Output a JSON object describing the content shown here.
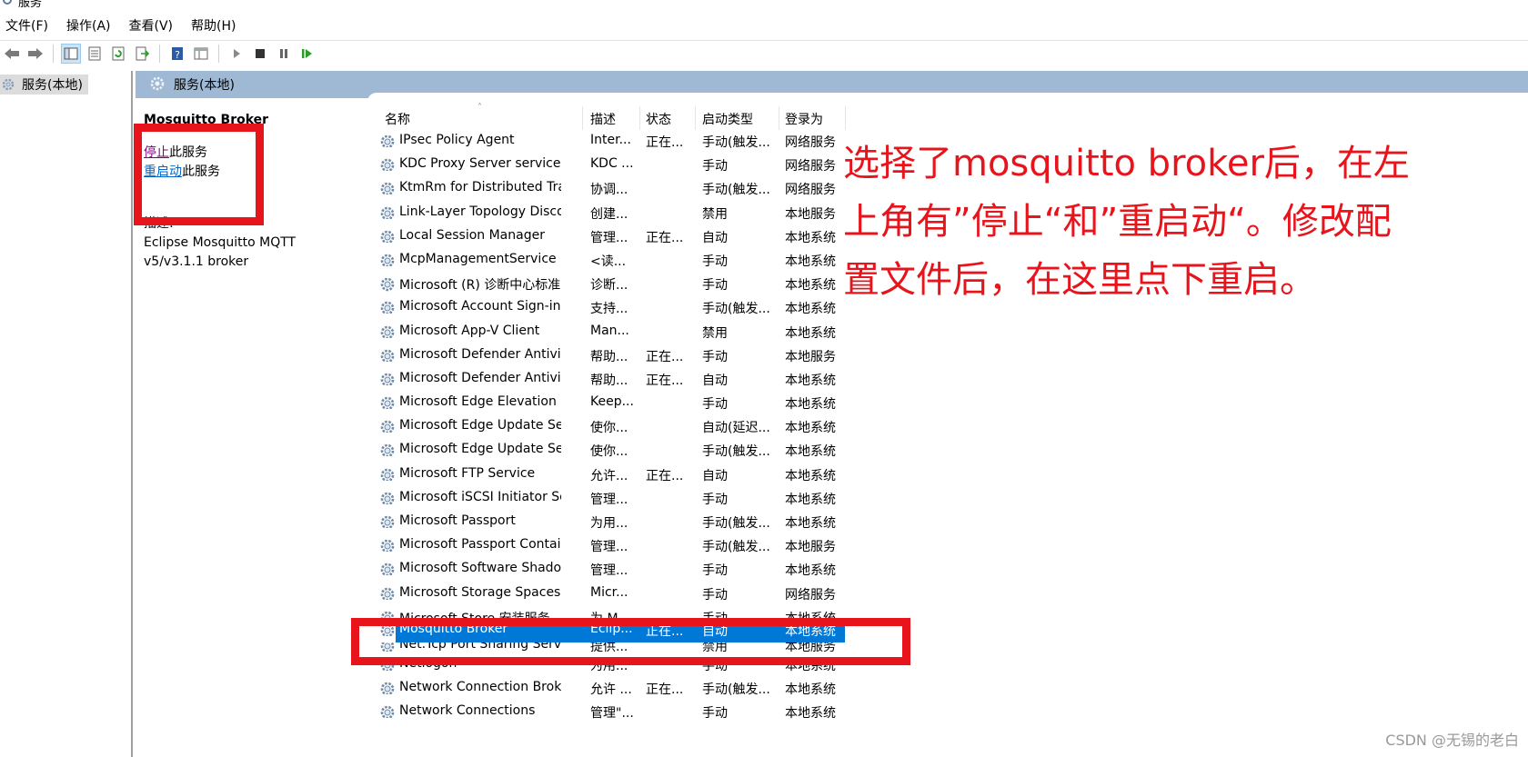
{
  "window": {
    "title": "服务"
  },
  "menu": {
    "items": [
      "文件(F)",
      "操作(A)",
      "查看(V)",
      "帮助(H)"
    ]
  },
  "toolbar": {
    "buttons": [
      "back-icon",
      "forward-icon",
      "console-tree-icon",
      "properties-icon",
      "refresh-icon",
      "export-icon",
      "help-icon",
      "view-icon",
      "start-icon",
      "stop-icon",
      "pause-icon",
      "restart-icon"
    ]
  },
  "tree": {
    "root_label": "服务(本地)"
  },
  "main": {
    "header_title": "服务(本地)"
  },
  "detail": {
    "service_name": "Mosquitto Broker",
    "stop_link": "停止",
    "stop_suffix": "此服务",
    "restart_link": "重启动",
    "restart_suffix": "此服务",
    "desc_label": "描述:",
    "desc_line1": "Eclipse Mosquitto MQTT",
    "desc_line2": "v5/v3.1.1 broker"
  },
  "table": {
    "columns": {
      "name": "名称",
      "desc": "描述",
      "status": "状态",
      "start": "启动类型",
      "logon": "登录为"
    },
    "rows": [
      {
        "name": "IPsec Policy Agent",
        "desc": "Inter...",
        "status": "正在...",
        "start": "手动(触发...",
        "logon": "网络服务"
      },
      {
        "name": "KDC Proxy Server service (...",
        "desc": "KDC ...",
        "status": "",
        "start": "手动",
        "logon": "网络服务"
      },
      {
        "name": "KtmRm for Distributed Tra...",
        "desc": "协调...",
        "status": "",
        "start": "手动(触发...",
        "logon": "网络服务"
      },
      {
        "name": "Link-Layer Topology Disco...",
        "desc": "创建...",
        "status": "",
        "start": "禁用",
        "logon": "本地服务"
      },
      {
        "name": "Local Session Manager",
        "desc": "管理...",
        "status": "正在...",
        "start": "自动",
        "logon": "本地系统"
      },
      {
        "name": "McpManagementService",
        "desc": "<读...",
        "status": "",
        "start": "手动",
        "logon": "本地系统"
      },
      {
        "name": "Microsoft (R) 诊断中心标准...",
        "desc": "诊断...",
        "status": "",
        "start": "手动",
        "logon": "本地系统"
      },
      {
        "name": "Microsoft Account Sign-in ...",
        "desc": "支持...",
        "status": "",
        "start": "手动(触发...",
        "logon": "本地系统"
      },
      {
        "name": "Microsoft App-V Client",
        "desc": "Man...",
        "status": "",
        "start": "禁用",
        "logon": "本地系统"
      },
      {
        "name": "Microsoft Defender Antivir...",
        "desc": "帮助...",
        "status": "正在...",
        "start": "手动",
        "logon": "本地服务"
      },
      {
        "name": "Microsoft Defender Antivir...",
        "desc": "帮助...",
        "status": "正在...",
        "start": "自动",
        "logon": "本地系统"
      },
      {
        "name": "Microsoft Edge Elevation S...",
        "desc": "Keep...",
        "status": "",
        "start": "手动",
        "logon": "本地系统"
      },
      {
        "name": "Microsoft Edge Update Ser...",
        "desc": "使你...",
        "status": "",
        "start": "自动(延迟...",
        "logon": "本地系统"
      },
      {
        "name": "Microsoft Edge Update Ser...",
        "desc": "使你...",
        "status": "",
        "start": "手动(触发...",
        "logon": "本地系统"
      },
      {
        "name": "Microsoft FTP Service",
        "desc": "允许...",
        "status": "正在...",
        "start": "自动",
        "logon": "本地系统"
      },
      {
        "name": "Microsoft iSCSI Initiator Ser...",
        "desc": "管理...",
        "status": "",
        "start": "手动",
        "logon": "本地系统"
      },
      {
        "name": "Microsoft Passport",
        "desc": "为用...",
        "status": "",
        "start": "手动(触发...",
        "logon": "本地系统"
      },
      {
        "name": "Microsoft Passport Container",
        "desc": "管理...",
        "status": "",
        "start": "手动(触发...",
        "logon": "本地服务"
      },
      {
        "name": "Microsoft Software Shado...",
        "desc": "管理...",
        "status": "",
        "start": "手动",
        "logon": "本地系统"
      },
      {
        "name": "Microsoft Storage Spaces S...",
        "desc": "Micr...",
        "status": "",
        "start": "手动",
        "logon": "网络服务"
      },
      {
        "name": "Microsoft Store 安装服务",
        "desc": "为 M...",
        "status": "",
        "start": "手动",
        "logon": "本地系统"
      },
      {
        "name": "Mosquitto Broker",
        "desc": "Eclip...",
        "status": "正在...",
        "start": "自动",
        "logon": "本地系统"
      },
      {
        "name": "Net.Tcp Port Sharing Service",
        "desc": "提供...",
        "status": "",
        "start": "禁用",
        "logon": "本地服务"
      },
      {
        "name": "Netlogon",
        "desc": "为用...",
        "status": "",
        "start": "手动",
        "logon": "本地系统"
      },
      {
        "name": "Network Connection Broker",
        "desc": "允许 ...",
        "status": "正在...",
        "start": "手动(触发...",
        "logon": "本地系统"
      },
      {
        "name": "Network Connections",
        "desc": "管理\"...",
        "status": "",
        "start": "手动",
        "logon": "本地系统"
      }
    ]
  },
  "annotation": {
    "text": "选择了mosquitto broker后，在左上角有”停止“和”重启动“。修改配置文件后，在这里点下重启。"
  },
  "watermark": "CSDN @无锡的老白",
  "colors": {
    "selection": "#0078d7",
    "header_band": "#9fb8d3",
    "annotation_red": "#e8141c",
    "link": "#0066cc"
  }
}
